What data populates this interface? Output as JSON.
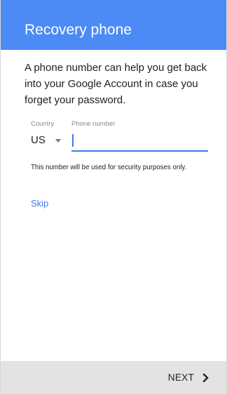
{
  "header": {
    "title": "Recovery phone",
    "color": "#4c8bf5"
  },
  "description": "A phone number can help you get back into your Google Account in case you forget your password.",
  "form": {
    "country_label": "Country",
    "country_value": "US",
    "phone_label": "Phone number",
    "phone_value": "",
    "helper_text": "This number will be used for security purposes only.",
    "accent_color": "#3f7de8"
  },
  "skip_label": "Skip",
  "footer": {
    "next_label": "NEXT",
    "next_icon": "chevron-right-icon"
  }
}
